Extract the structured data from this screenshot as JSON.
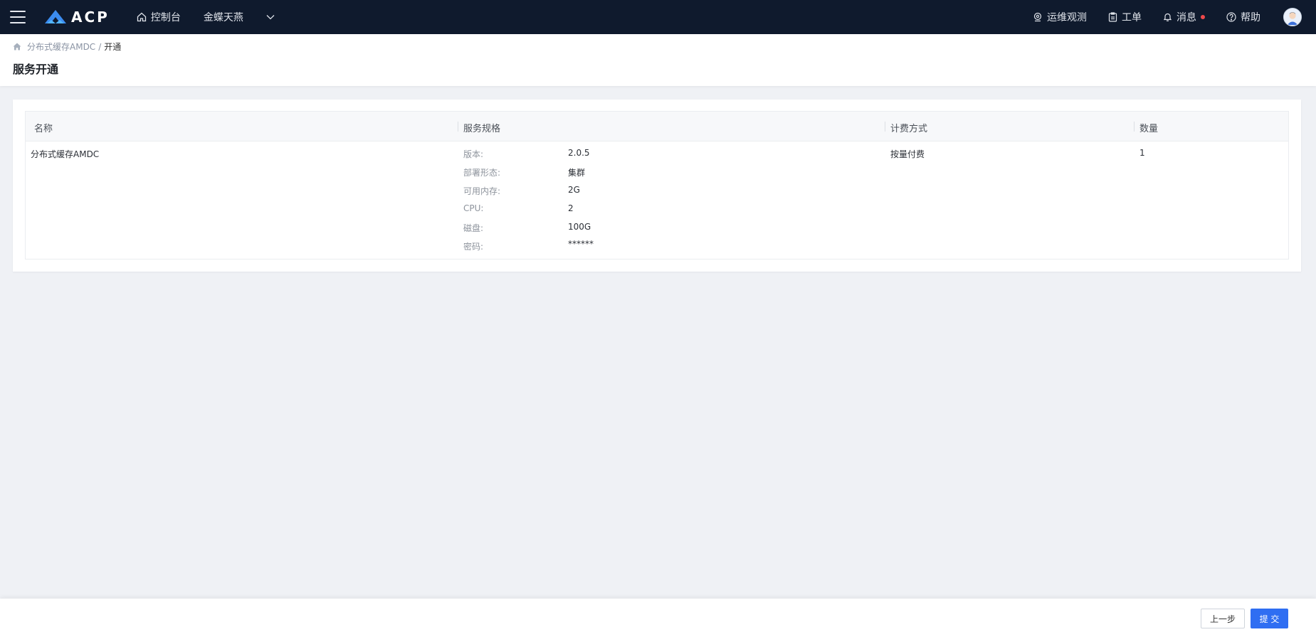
{
  "topbar": {
    "logo_text": "ACP",
    "console_label": "控制台",
    "tenant_label": "金蝶天燕",
    "ops_label": "运维观测",
    "ticket_label": "工单",
    "message_label": "消息",
    "help_label": "帮助",
    "message_dot_color": "#f0494b"
  },
  "breadcrumb": {
    "parent": "分布式缓存AMDC",
    "separator": "/",
    "current": "开通"
  },
  "page_title": "服务开通",
  "table": {
    "headers": [
      "名称",
      "服务规格",
      "计费方式",
      "数量"
    ],
    "row": {
      "name": "分布式缓存AMDC",
      "specs": [
        {
          "label": "版本:",
          "value": "2.0.5"
        },
        {
          "label": "部署形态:",
          "value": "集群"
        },
        {
          "label": "可用内存:",
          "value": "2G"
        },
        {
          "label": "CPU:",
          "value": "2"
        },
        {
          "label": "磁盘:",
          "value": "100G"
        },
        {
          "label": "密码:",
          "value": "******"
        }
      ],
      "billing": "按量付费",
      "quantity": "1"
    }
  },
  "footer": {
    "prev_label": "上一步",
    "submit_label": "提 交"
  },
  "colors": {
    "topbar_bg": "#0f1a2d",
    "primary": "#2f6ef2",
    "page_bg": "#eff1f5"
  }
}
